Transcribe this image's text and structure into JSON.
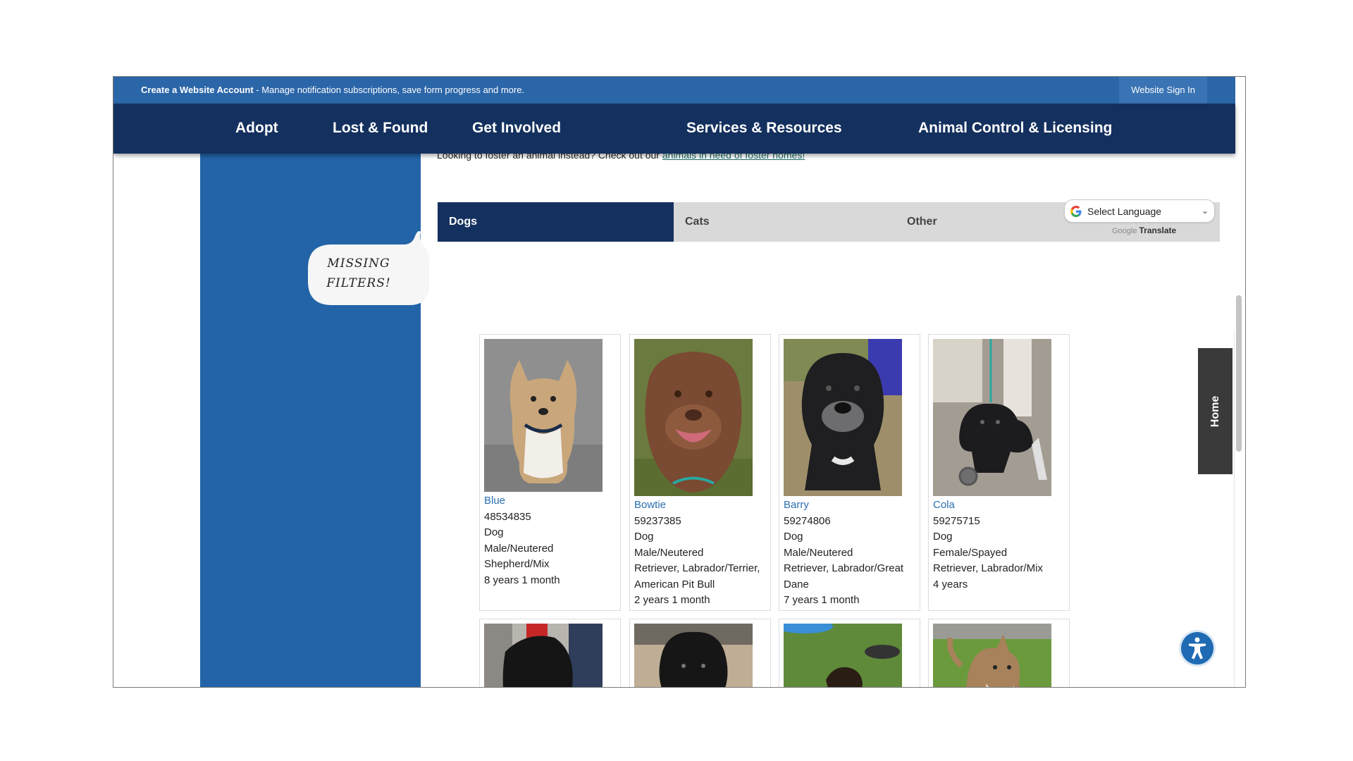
{
  "topbar": {
    "account_link": "Create a Website Account",
    "account_desc": " - Manage notification subscriptions, save form progress and more.",
    "signin": "Website Sign In"
  },
  "nav": {
    "items": [
      "Adopt",
      "Lost & Found",
      "Get Involved",
      "Services & Resources",
      "Animal Control & Licensing"
    ]
  },
  "content": {
    "foster_text": "Looking to foster an animal instead? Check out our ",
    "foster_link": "animals in need of foster homes!"
  },
  "tabs": [
    "Dogs",
    "Cats",
    "Other"
  ],
  "translate": {
    "select_label": "Select Language",
    "powered_google": "Google",
    "powered_translate": "Translate"
  },
  "animals": [
    {
      "name": "Blue",
      "id": "48534835",
      "species": "Dog",
      "sex": "Male/Neutered",
      "breed": "Shepherd/Mix",
      "age": "8 years 1 month"
    },
    {
      "name": "Bowtie",
      "id": "59237385",
      "species": "Dog",
      "sex": "Male/Neutered",
      "breed": "Retriever, Labrador/Terrier, American Pit Bull",
      "age": "2 years 1 month"
    },
    {
      "name": "Barry",
      "id": "59274806",
      "species": "Dog",
      "sex": "Male/Neutered",
      "breed": "Retriever, Labrador/Great Dane",
      "age": "7 years 1 month"
    },
    {
      "name": "Cola",
      "id": "59275715",
      "species": "Dog",
      "sex": "Female/Spayed",
      "breed": "Retriever, Labrador/Mix",
      "age": "4 years"
    }
  ],
  "home_tab": "Home",
  "annotation": {
    "line1": "MISSING",
    "line2": "FILTERS!"
  },
  "colors": {
    "topbar": "#2b66a8",
    "nav": "#14305e",
    "sidebar": "#2364a8",
    "link": "#2a6fb0"
  }
}
